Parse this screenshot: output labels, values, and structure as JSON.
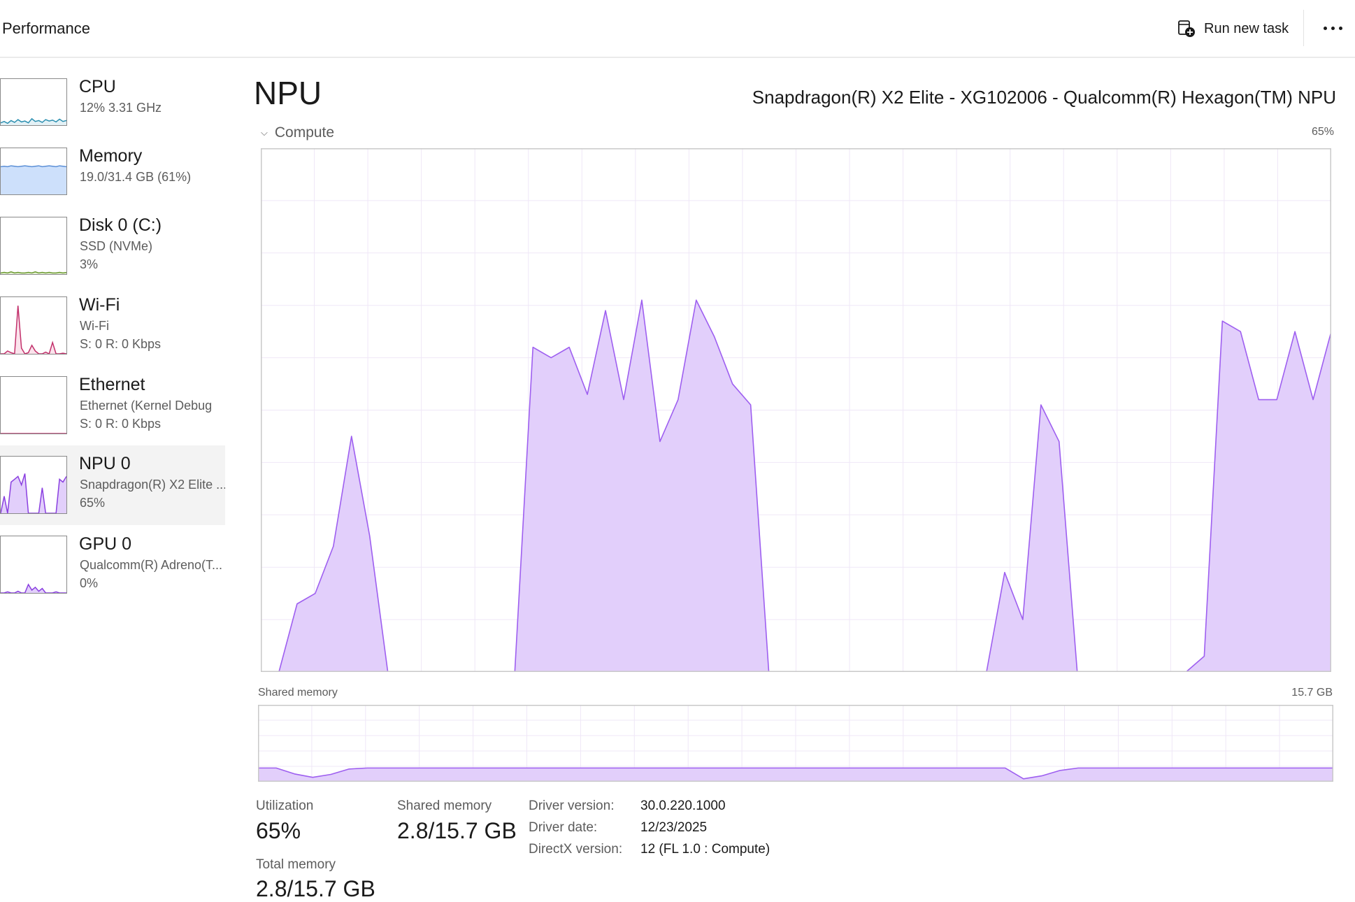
{
  "header": {
    "title": "Performance",
    "run_task_label": "Run new task"
  },
  "sidebar": {
    "items": [
      {
        "name": "CPU",
        "line1": "12%  3.31 GHz",
        "line2": "",
        "color": "#2b8fb0",
        "fill": "#e3f1f6"
      },
      {
        "name": "Memory",
        "line1": "19.0/31.4 GB (61%)",
        "line2": "",
        "color": "#5b8fd6",
        "fill": "#cde0fb"
      },
      {
        "name": "Disk 0 (C:)",
        "line1": "SSD (NVMe)",
        "line2": "3%",
        "color": "#6b9a2e",
        "fill": "#e7f2d9"
      },
      {
        "name": "Wi-Fi",
        "line1": "Wi-Fi",
        "line2": "S: 0  R: 0 Kbps",
        "color": "#c2306b",
        "fill": "#fbe3ec"
      },
      {
        "name": "Ethernet",
        "line1": "Ethernet (Kernel Debug",
        "line2": "S: 0  R: 0 Kbps",
        "color": "#c2306b",
        "fill": "#fbe3ec"
      },
      {
        "name": "NPU 0",
        "line1": "Snapdragon(R) X2 Elite ...",
        "line2": "65%",
        "color": "#8a3fe0",
        "fill": "#e2cffb"
      },
      {
        "name": "GPU 0",
        "line1": "Qualcomm(R) Adreno(T...",
        "line2": "0%",
        "color": "#8a3fe0",
        "fill": "#e2cffb"
      }
    ],
    "selected": "NPU 0"
  },
  "main": {
    "title": "NPU",
    "device": "Snapdragon(R) X2 Elite - XG102006 - Qualcomm(R) Hexagon(TM) NPU",
    "compute_label": "Compute",
    "compute_max": "65%",
    "shared_label": "Shared memory",
    "shared_max": "15.7 GB"
  },
  "stats": {
    "utilization_label": "Utilization",
    "utilization_value": "65%",
    "shared_memory_label": "Shared memory",
    "shared_memory_value": "2.8/15.7 GB",
    "total_memory_label": "Total memory",
    "total_memory_value": "2.8/15.7 GB"
  },
  "info": {
    "driver_version_label": "Driver version:",
    "driver_version": "30.0.220.1000",
    "driver_date_label": "Driver date:",
    "driver_date": "12/23/2025",
    "directx_label": "DirectX version:",
    "directx_version": "12 (FL 1.0 : Compute)"
  },
  "colors": {
    "npu_line": "#9e5ff0",
    "npu_fill": "#e2cffb",
    "grid": "#efe7f7",
    "frame": "#c9c9c9"
  },
  "chart_data": [
    {
      "type": "area",
      "name": "Compute",
      "ylim": [
        0,
        100
      ],
      "grid": true,
      "x": [
        0,
        1,
        2,
        3,
        4,
        5,
        6,
        7,
        8,
        9,
        10,
        11,
        12,
        13,
        14,
        15,
        16,
        17,
        18,
        19,
        20,
        21,
        22,
        23,
        24,
        25,
        26,
        27,
        28,
        29,
        30,
        31,
        32,
        33,
        34,
        35,
        36,
        37,
        38,
        39,
        40,
        41,
        42,
        43,
        44,
        45,
        46,
        47,
        48,
        49,
        50,
        51,
        52,
        53,
        54,
        55,
        56,
        57,
        58,
        59
      ],
      "values": [
        0,
        0,
        13,
        15,
        24,
        45,
        26,
        0,
        0,
        0,
        0,
        0,
        0,
        0,
        0,
        62,
        60,
        62,
        53,
        69,
        52,
        71,
        44,
        52,
        71,
        64,
        55,
        51,
        0,
        0,
        0,
        0,
        0,
        0,
        0,
        0,
        0,
        0,
        0,
        0,
        0,
        19,
        10,
        51,
        44,
        0,
        0,
        0,
        0,
        0,
        0,
        0,
        3,
        67,
        65,
        52,
        52,
        65,
        52,
        65
      ]
    },
    {
      "type": "area",
      "name": "Shared memory",
      "ylim": [
        0,
        15.7
      ],
      "grid": true,
      "x": [
        0,
        1,
        2,
        3,
        4,
        5,
        6,
        7,
        8,
        9,
        10,
        11,
        12,
        13,
        14,
        15,
        16,
        17,
        18,
        19,
        20,
        21,
        22,
        23,
        24,
        25,
        26,
        27,
        28,
        29,
        30,
        31,
        32,
        33,
        34,
        35,
        36,
        37,
        38,
        39,
        40,
        41,
        42,
        43,
        44,
        45,
        46,
        47,
        48,
        49,
        50,
        51,
        52,
        53,
        54,
        55,
        56,
        57,
        58,
        59
      ],
      "values": [
        2.8,
        2.8,
        1.6,
        0.9,
        1.5,
        2.6,
        2.8,
        2.8,
        2.8,
        2.8,
        2.8,
        2.8,
        2.8,
        2.8,
        2.8,
        2.8,
        2.8,
        2.8,
        2.8,
        2.8,
        2.8,
        2.8,
        2.8,
        2.8,
        2.8,
        2.8,
        2.8,
        2.8,
        2.8,
        2.8,
        2.8,
        2.8,
        2.8,
        2.8,
        2.8,
        2.8,
        2.8,
        2.8,
        2.8,
        2.8,
        2.8,
        2.8,
        0.6,
        1.2,
        2.3,
        2.8,
        2.8,
        2.8,
        2.8,
        2.8,
        2.8,
        2.8,
        2.8,
        2.8,
        2.8,
        2.8,
        2.8,
        2.8,
        2.8,
        2.8
      ]
    }
  ]
}
